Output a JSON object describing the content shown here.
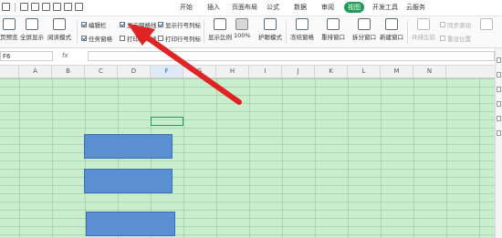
{
  "title_bar": {
    "tabs": [
      "开始",
      "插入",
      "页面布局",
      "公式",
      "数据",
      "审阅",
      "视图",
      "开发工具",
      "云服务"
    ],
    "active_tab": "视图"
  },
  "ribbon": {
    "buttons": {
      "page_break_preview": "页预览",
      "full_screen": "全屏显示",
      "reading_mode": "阅读模式",
      "zoom": "显示比例",
      "zoom_100": "100%",
      "eye_protection": "护眼模式",
      "freeze_panes": "冻结窗格",
      "rearrange_windows": "重排窗口",
      "split_window": "拆分窗口",
      "new_window": "新建窗口",
      "side_by_side": "并排比较",
      "sync_scroll": "同步滚动",
      "reset_position": "重设位置"
    },
    "checkboxes": {
      "edit_bar": "编辑栏",
      "task_pane": "任务窗格",
      "show_gridlines": "显示网格线",
      "print_gridlines": "打印网格线",
      "show_headings": "显示行号列标",
      "print_headings": "打印行号列标"
    }
  },
  "formula_bar": {
    "name_box": "F6",
    "fx_label": "fx",
    "formula": ""
  },
  "columns": [
    "A",
    "B",
    "C",
    "D",
    "E",
    "F",
    "G",
    "H",
    "I",
    "J",
    "K",
    "L",
    "M",
    "N"
  ],
  "active_column": "F",
  "colors": {
    "grid_background": "#c9eecd",
    "active_tab": "#1e9b57",
    "shape_fill": "#5b8fd4",
    "arrow": "#e02424"
  }
}
